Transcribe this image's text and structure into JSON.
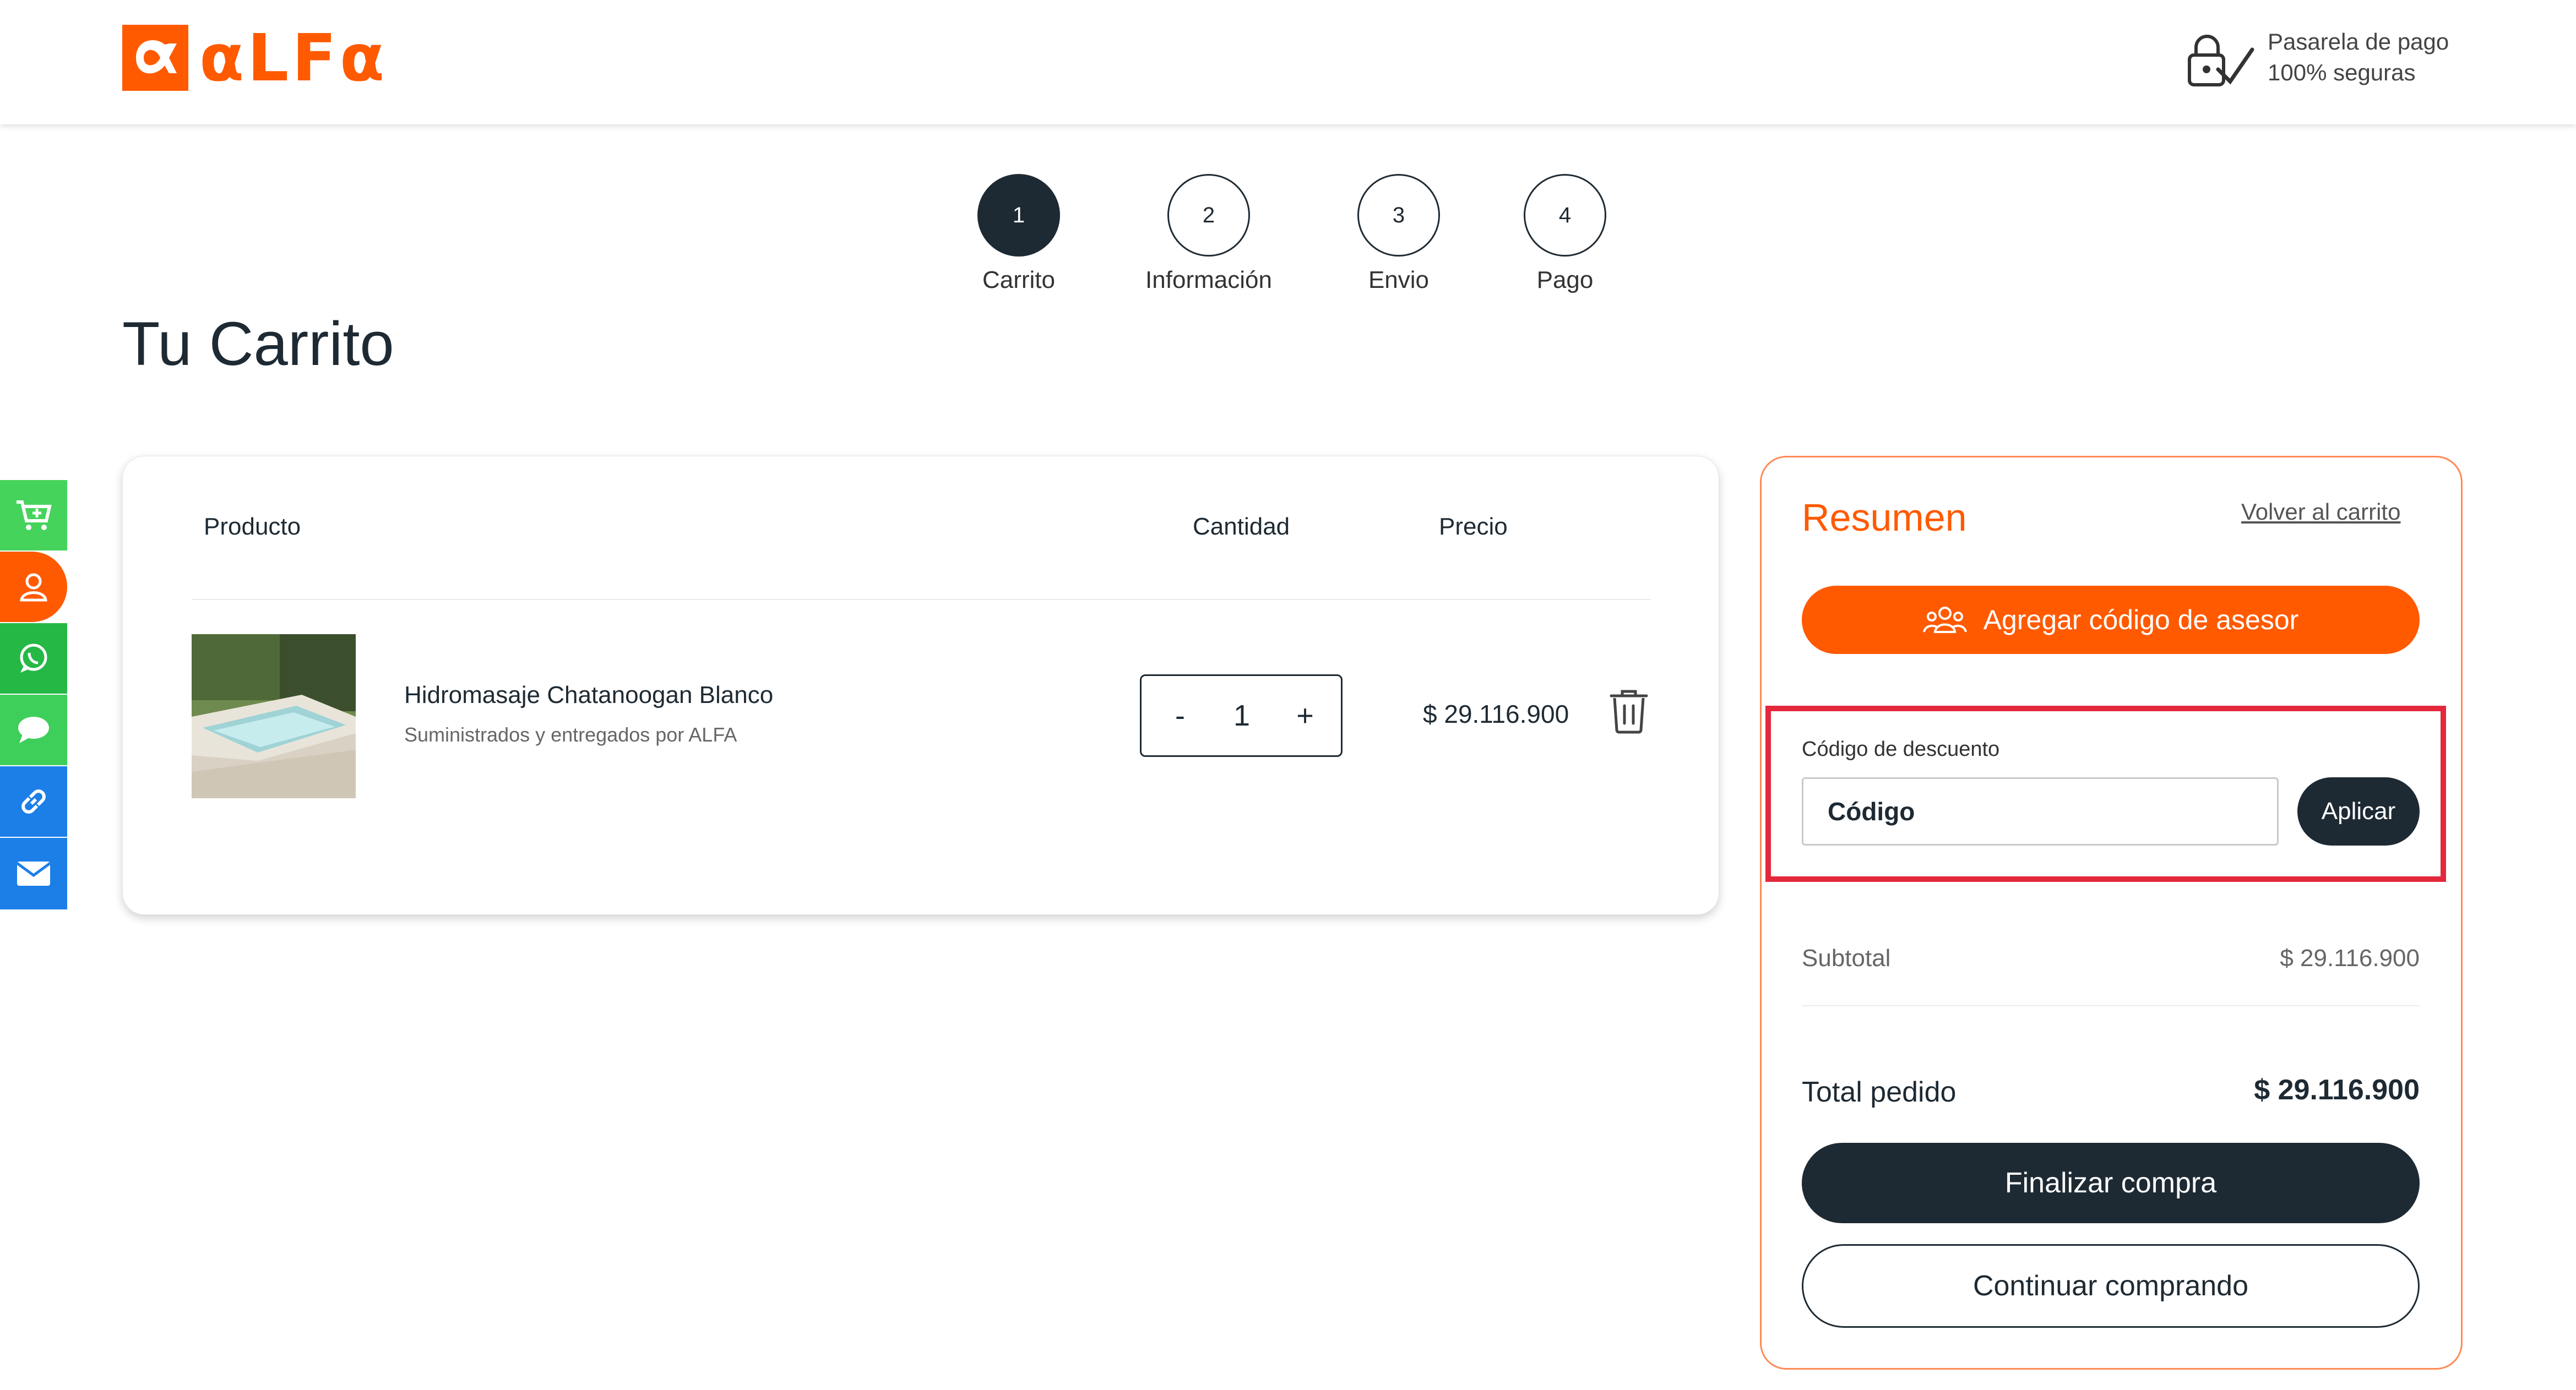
{
  "header": {
    "logo_text": "αLFα",
    "secure_line1": "Pasarela de pago",
    "secure_line2": "100% seguras"
  },
  "steps": [
    {
      "number": "1",
      "label": "Carrito",
      "active": true
    },
    {
      "number": "2",
      "label": "Información",
      "active": false
    },
    {
      "number": "3",
      "label": "Envio",
      "active": false
    },
    {
      "number": "4",
      "label": "Pago",
      "active": false
    }
  ],
  "page_title": "Tu Carrito",
  "side_bar": [
    {
      "icon": "cart-plus-icon",
      "color": "#46d35c"
    },
    {
      "icon": "user-icon",
      "color": "#ff5a00"
    },
    {
      "icon": "whatsapp-icon",
      "color": "#25b845"
    },
    {
      "icon": "chat-icon",
      "color": "#3ecf5a"
    },
    {
      "icon": "link-icon",
      "color": "#1c7fe8"
    },
    {
      "icon": "mail-icon",
      "color": "#1c7fe8"
    }
  ],
  "cart": {
    "col_product": "Producto",
    "col_quantity": "Cantidad",
    "col_price": "Precio",
    "item": {
      "name": "Hidromasaje Chatanoogan Blanco",
      "supplier": "Suministrados y entregados por ALFA",
      "quantity": "1",
      "minus": "-",
      "plus": "+",
      "price": "$ 29.116.900"
    }
  },
  "summary": {
    "title": "Resumen",
    "back_link": "Volver al carrito",
    "advisor_button": "Agregar código de asesor",
    "discount_label": "Código de descuento",
    "code_placeholder": "Código",
    "apply_button": "Aplicar",
    "subtotal_label": "Subtotal",
    "subtotal_value": "$ 29.116.900",
    "total_label": "Total pedido",
    "total_value": "$ 29.116.900",
    "finish_button": "Finalizar compra",
    "continue_button": "Continuar comprando"
  },
  "colors": {
    "brand": "#ff5a00",
    "dark": "#1e2a33",
    "highlight": "#e3283c"
  }
}
